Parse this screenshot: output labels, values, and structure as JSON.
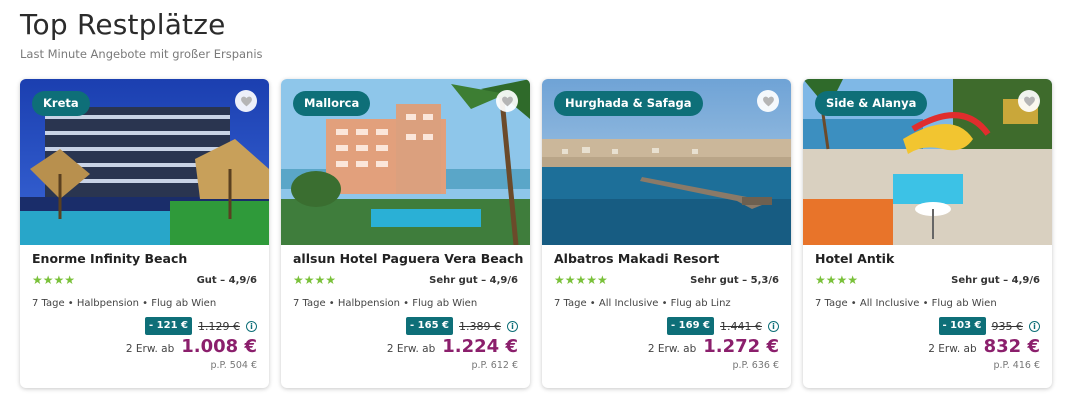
{
  "header": {
    "title": "Top Restplätze",
    "subtitle": "Last Minute Angebote mit großer Erspanis"
  },
  "cards": [
    {
      "region": "Kreta",
      "hotel": "Enorme Infinity Beach",
      "stars": "★★★★",
      "rating": "Gut – 4,9/6",
      "info": "7 Tage • Halbpension • Flug ab Wien",
      "discount": "- 121 €",
      "old_price": "1.129 €",
      "price_prefix": "2 Erw. ab",
      "price": "1.008 €",
      "per_person": "p.P. 504 €"
    },
    {
      "region": "Mallorca",
      "hotel": "allsun Hotel Paguera Vera Beach",
      "stars": "★★★★",
      "rating": "Sehr gut – 4,9/6",
      "info": "7 Tage • Halbpension • Flug ab Wien",
      "discount": "- 165 €",
      "old_price": "1.389 €",
      "price_prefix": "2 Erw. ab",
      "price": "1.224 €",
      "per_person": "p.P. 612 €"
    },
    {
      "region": "Hurghada & Safaga",
      "hotel": "Albatros Makadi Resort",
      "stars": "★★★★★",
      "rating": "Sehr gut – 5,3/6",
      "info": "7 Tage • All Inclusive • Flug ab Linz",
      "discount": "- 169 €",
      "old_price": "1.441 €",
      "price_prefix": "2 Erw. ab",
      "price": "1.272 €",
      "per_person": "p.P. 636 €"
    },
    {
      "region": "Side & Alanya",
      "hotel": "Hotel Antik",
      "stars": "★★★★",
      "rating": "Sehr gut – 4,9/6",
      "info": "7 Tage • All Inclusive • Flug ab Wien",
      "discount": "- 103 €",
      "old_price": "935 €",
      "price_prefix": "2 Erw. ab",
      "price": "832 €",
      "per_person": "p.P. 416 €"
    }
  ],
  "icons": {
    "favorite": "heart-icon",
    "info": "info-icon"
  },
  "colors": {
    "accent": "#0e6f78",
    "price": "#8b1f6c",
    "stars": "#7ac13a"
  }
}
